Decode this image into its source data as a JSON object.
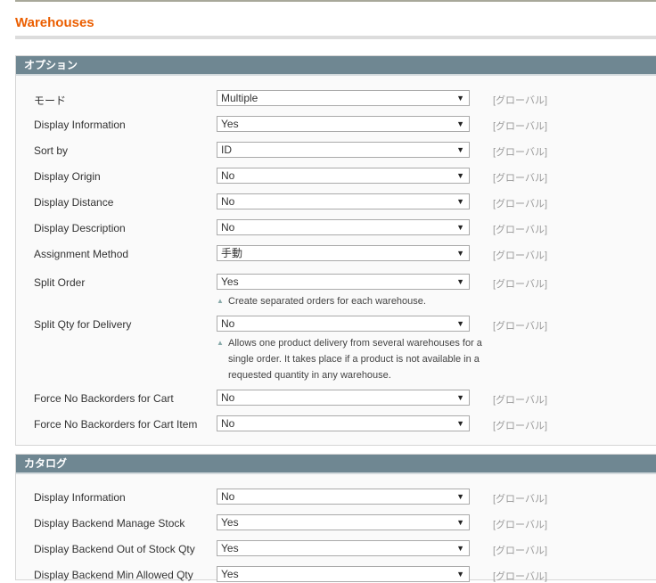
{
  "title": "Warehouses",
  "scope_label": "[グローバル]",
  "sections": [
    {
      "title": "オプション",
      "rows": [
        {
          "label": "モード",
          "value": "Multiple"
        },
        {
          "label": "Display Information",
          "value": "Yes"
        },
        {
          "label": "Sort by",
          "value": "ID"
        },
        {
          "label": "Display Origin",
          "value": "No"
        },
        {
          "label": "Display Distance",
          "value": "No"
        },
        {
          "label": "Display Description",
          "value": "No"
        },
        {
          "label": "Assignment Method",
          "value": "手動"
        },
        {
          "label": "Split Order",
          "value": "Yes",
          "note": "Create separated orders for each warehouse."
        },
        {
          "label": "Split Qty for Delivery",
          "value": "No",
          "note": "Allows one product delivery from several warehouses for a single order. It takes place if a product is not available in a requested quantity in any warehouse."
        },
        {
          "label": "Force No Backorders for Cart",
          "value": "No"
        },
        {
          "label": "Force No Backorders for Cart Item",
          "value": "No"
        }
      ]
    },
    {
      "title": "カタログ",
      "rows": [
        {
          "label": "Display Information",
          "value": "No"
        },
        {
          "label": "Display Backend Manage Stock",
          "value": "Yes"
        },
        {
          "label": "Display Backend Out of Stock Qty",
          "value": "Yes"
        },
        {
          "label": "Display Backend Min Allowed Qty",
          "value": "Yes"
        }
      ]
    }
  ]
}
